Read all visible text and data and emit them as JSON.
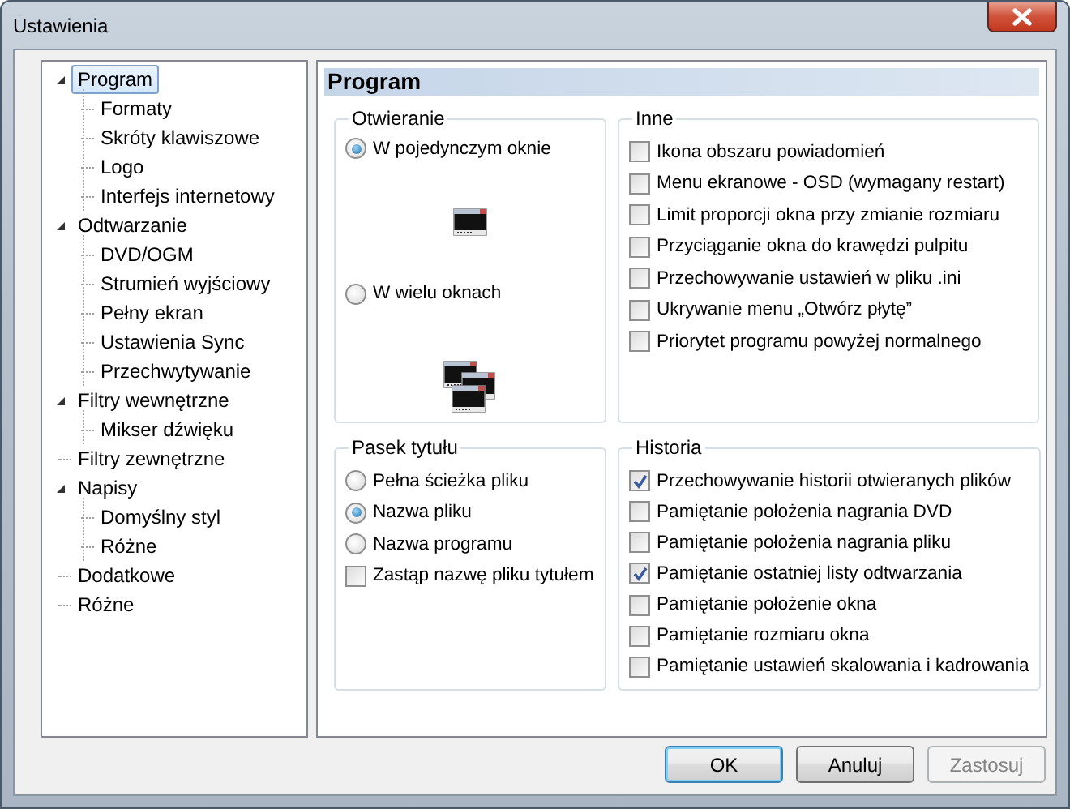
{
  "window": {
    "title": "Ustawienia"
  },
  "tree": [
    {
      "label": "Program",
      "selected": true,
      "expanded": true,
      "children": [
        {
          "label": "Formaty",
          "selected": false
        },
        {
          "label": "Skróty klawiszowe",
          "selected": false
        },
        {
          "label": "Logo",
          "selected": false
        },
        {
          "label": "Interfejs internetowy",
          "selected": false
        }
      ]
    },
    {
      "label": "Odtwarzanie",
      "selected": false,
      "expanded": true,
      "children": [
        {
          "label": "DVD/OGM",
          "selected": false
        },
        {
          "label": "Strumień wyjściowy",
          "selected": false
        },
        {
          "label": "Pełny ekran",
          "selected": false
        },
        {
          "label": "Ustawienia Sync",
          "selected": false
        },
        {
          "label": "Przechwytywanie",
          "selected": false
        }
      ]
    },
    {
      "label": "Filtry wewnętrzne",
      "selected": false,
      "expanded": true,
      "children": [
        {
          "label": "Mikser dźwięku",
          "selected": false
        }
      ]
    },
    {
      "label": "Filtry zewnętrzne",
      "selected": false
    },
    {
      "label": "Napisy",
      "selected": false,
      "expanded": true,
      "children": [
        {
          "label": "Domyślny styl",
          "selected": false
        },
        {
          "label": "Różne",
          "selected": false
        }
      ]
    },
    {
      "label": "Dodatkowe",
      "selected": false
    },
    {
      "label": "Różne",
      "selected": false
    }
  ],
  "page": {
    "title": "Program"
  },
  "groups": [
    {
      "title": "Otwieranie",
      "kind": "preview",
      "options": [
        {
          "kind": "radio",
          "label": "W pojedynczym oknie",
          "selected": true
        },
        {
          "kind": "radio",
          "label": "W wielu oknach",
          "selected": false
        }
      ]
    },
    {
      "title": "Inne",
      "kind": "list",
      "options": [
        {
          "kind": "checkbox",
          "label": "Ikona obszaru powiadomień",
          "checked": false
        },
        {
          "kind": "checkbox",
          "label": "Menu ekranowe - OSD (wymagany restart)",
          "checked": false
        },
        {
          "kind": "checkbox",
          "label": "Limit proporcji okna przy zmianie rozmiaru",
          "checked": false
        },
        {
          "kind": "checkbox",
          "label": "Przyciąganie okna do krawędzi pulpitu",
          "checked": false
        },
        {
          "kind": "checkbox",
          "label": "Przechowywanie ustawień w pliku .ini",
          "checked": false
        },
        {
          "kind": "checkbox",
          "label": "Ukrywanie menu „Otwórz płytę”",
          "checked": false
        },
        {
          "kind": "checkbox",
          "label": "Priorytet programu powyżej normalnego",
          "checked": false
        }
      ]
    },
    {
      "title": "Pasek tytułu",
      "kind": "list",
      "options": [
        {
          "kind": "radio",
          "label": "Pełna ścieżka pliku",
          "selected": false
        },
        {
          "kind": "radio",
          "label": "Nazwa pliku",
          "selected": true
        },
        {
          "kind": "radio",
          "label": "Nazwa programu",
          "selected": false
        },
        {
          "kind": "checkbox",
          "label": "Zastąp nazwę pliku tytułem",
          "checked": false
        }
      ]
    },
    {
      "title": "Historia",
      "kind": "list",
      "options": [
        {
          "kind": "checkbox",
          "label": "Przechowywanie historii otwieranych plików",
          "checked": true
        },
        {
          "kind": "checkbox",
          "label": "Pamiętanie położenia nagrania DVD",
          "checked": false
        },
        {
          "kind": "checkbox",
          "label": "Pamiętanie położenia nagrania pliku",
          "checked": false
        },
        {
          "kind": "checkbox",
          "label": "Pamiętanie ostatniej listy odtwarzania",
          "checked": true
        },
        {
          "kind": "checkbox",
          "label": "Pamiętanie położenie okna",
          "checked": false
        },
        {
          "kind": "checkbox",
          "label": "Pamiętanie rozmiaru okna",
          "checked": false
        },
        {
          "kind": "checkbox",
          "label": "Pamiętanie ustawień skalowania i kadrowania",
          "checked": false
        }
      ]
    }
  ],
  "buttons": [
    {
      "label": "OK",
      "default": true,
      "disabled": false
    },
    {
      "label": "Anuluj",
      "default": false,
      "disabled": false
    },
    {
      "label": "Zastosuj",
      "default": false,
      "disabled": true
    }
  ]
}
